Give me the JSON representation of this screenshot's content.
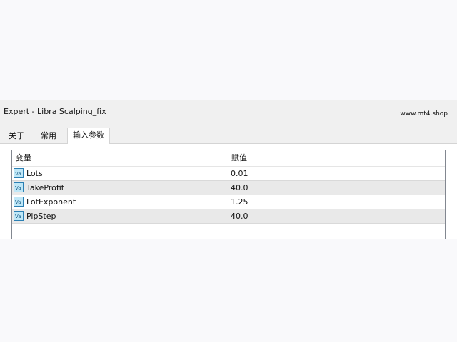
{
  "window": {
    "title": "Expert - Libra Scalping_fix",
    "watermark": "www.mt4.shop"
  },
  "tabs": [
    {
      "label": "关于"
    },
    {
      "label": "常用"
    },
    {
      "label": "输入参数"
    }
  ],
  "table": {
    "headers": [
      "变量",
      "赋值"
    ],
    "rows": [
      {
        "name": "Lots",
        "value": "0.01"
      },
      {
        "name": "TakeProfit",
        "value": "40.0"
      },
      {
        "name": "LotExponent",
        "value": "1.25"
      },
      {
        "name": "PipStep",
        "value": "40.0"
      }
    ]
  },
  "colors": {
    "icon_fill": "#bfe7f7",
    "icon_stroke": "#2b7fb3",
    "alt_row": "#e9e9e9"
  },
  "icons": {
    "row_icon": "variable-icon"
  }
}
